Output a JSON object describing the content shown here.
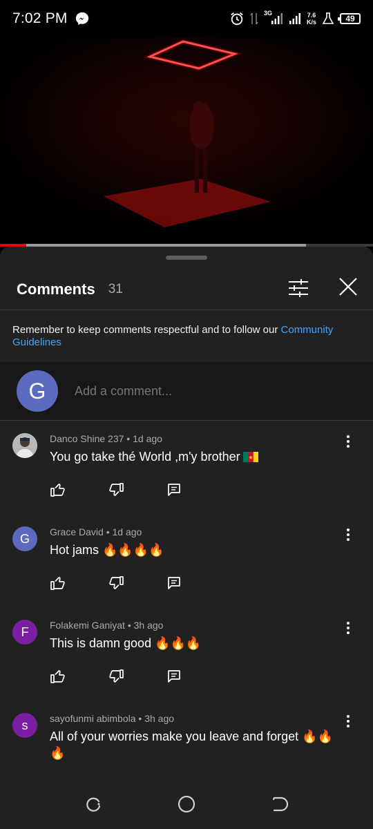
{
  "status_bar": {
    "time": "7:02 PM",
    "network_type": "3G",
    "speed_value": "7.6",
    "speed_unit": "K/s",
    "battery": "49",
    "icons": [
      "messenger-icon",
      "alarm-icon",
      "data-arrows-icon",
      "signal-icon",
      "signal-icon",
      "flask-icon",
      "battery-icon"
    ]
  },
  "video": {
    "played_fraction": 0.07,
    "buffered_fraction": 0.82
  },
  "comments_sheet": {
    "title": "Comments",
    "count": "31",
    "guidelines_text": "Remember to keep comments respectful and to follow our ",
    "guidelines_link": "Community Guidelines",
    "user_initial": "G",
    "input_placeholder": "Add a comment...",
    "comments": [
      {
        "author": "Danco Shine 237",
        "time": "1d ago",
        "text": "You go take thé World ,m'y brother",
        "avatar": "photo",
        "emoji": "flag-cameroon"
      },
      {
        "author": "Grace David",
        "time": "1d ago",
        "text": "Hot jams 🔥🔥🔥🔥",
        "avatar_initial": "G",
        "avatar_color": "#5c6bc0"
      },
      {
        "author": "Folakemi Ganiyat",
        "time": "3h ago",
        "text": "This is damn good 🔥🔥🔥",
        "avatar_initial": "F",
        "avatar_color": "#7b1fa2"
      },
      {
        "author": "sayofunmi abimbola",
        "time": "3h ago",
        "text": "All of your worries make you leave and forget 🔥🔥🔥",
        "avatar_initial": "s",
        "avatar_color": "#7b1fa2"
      }
    ]
  },
  "colors": {
    "sheet_bg": "#212121",
    "link": "#3ea6ff",
    "progress_played": "#ee0000"
  }
}
